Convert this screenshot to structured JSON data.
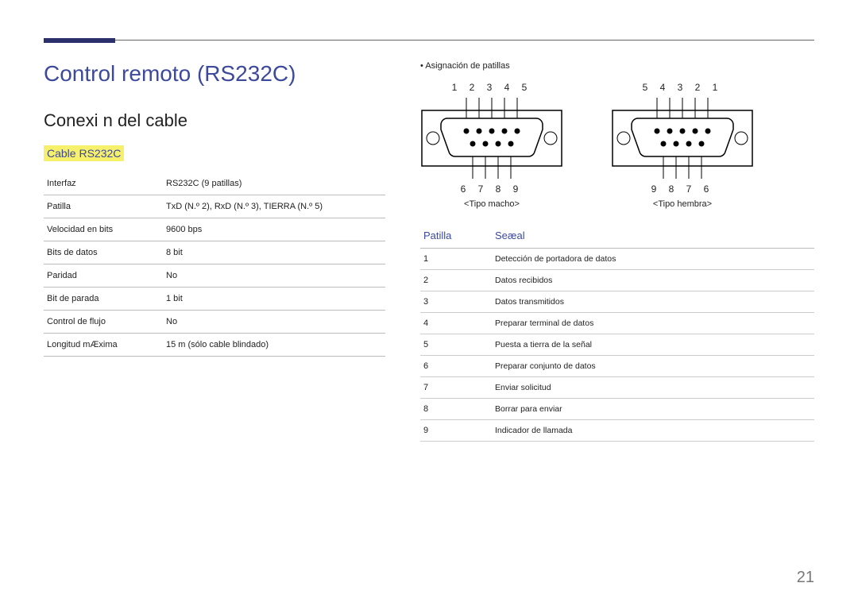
{
  "page_number": "21",
  "title": "Control remoto (RS232C)",
  "section": "Conexi n del cable",
  "subhead": "Cable RS232C",
  "spec_rows": [
    {
      "label": "Interfaz",
      "value": "RS232C (9 patillas)"
    },
    {
      "label": "Patilla",
      "value": "TxD (N.º 2), RxD (N.º 3), TIERRA (N.º 5)"
    },
    {
      "label": "Velocidad en bits",
      "value": "9600 bps"
    },
    {
      "label": "Bits de datos",
      "value": "8 bit"
    },
    {
      "label": "Paridad",
      "value": "No"
    },
    {
      "label": "Bit de parada",
      "value": "1 bit"
    },
    {
      "label": "Control de flujo",
      "value": "No"
    },
    {
      "label": "Longitud mÆxima",
      "value": "15 m (sólo cable blindado)"
    }
  ],
  "right": {
    "bullet": "Asignación de patillas",
    "male": {
      "top_nums": "1 2 3 4 5",
      "bottom_nums": "6 7 8 9",
      "caption": "<Tipo macho>"
    },
    "female": {
      "top_nums": "5 4 3 2 1",
      "bottom_nums": "9 8 7 6",
      "caption": "<Tipo hembra>"
    },
    "sig_header": {
      "pin": "Patilla",
      "signal": "Seæal"
    },
    "signals": [
      {
        "pin": "1",
        "desc": "Detección de portadora de datos"
      },
      {
        "pin": "2",
        "desc": "Datos recibidos"
      },
      {
        "pin": "3",
        "desc": "Datos transmitidos"
      },
      {
        "pin": "4",
        "desc": "Preparar terminal de datos"
      },
      {
        "pin": "5",
        "desc": "Puesta a tierra de la señal"
      },
      {
        "pin": "6",
        "desc": "Preparar conjunto de datos"
      },
      {
        "pin": "7",
        "desc": "Enviar solicitud"
      },
      {
        "pin": "8",
        "desc": "Borrar para enviar"
      },
      {
        "pin": "9",
        "desc": "Indicador de llamada"
      }
    ]
  }
}
